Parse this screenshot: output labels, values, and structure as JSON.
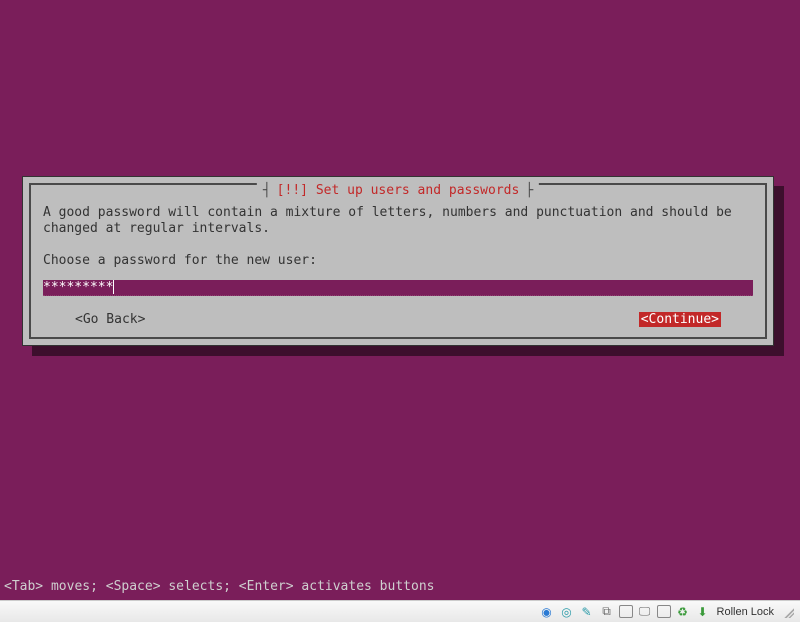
{
  "dialog": {
    "title": "[!!] Set up users and passwords",
    "help_text": "A good password will contain a mixture of letters, numbers and punctuation and should be\nchanged at regular intervals.",
    "prompt": "Choose a password for the new user:",
    "input_value": "*********",
    "go_back_label": "<Go Back>",
    "continue_label": "<Continue>"
  },
  "hint_bar": "<Tab> moves; <Space> selects; <Enter> activates buttons",
  "taskbar": {
    "indicator_label": "Rollen Lock"
  }
}
